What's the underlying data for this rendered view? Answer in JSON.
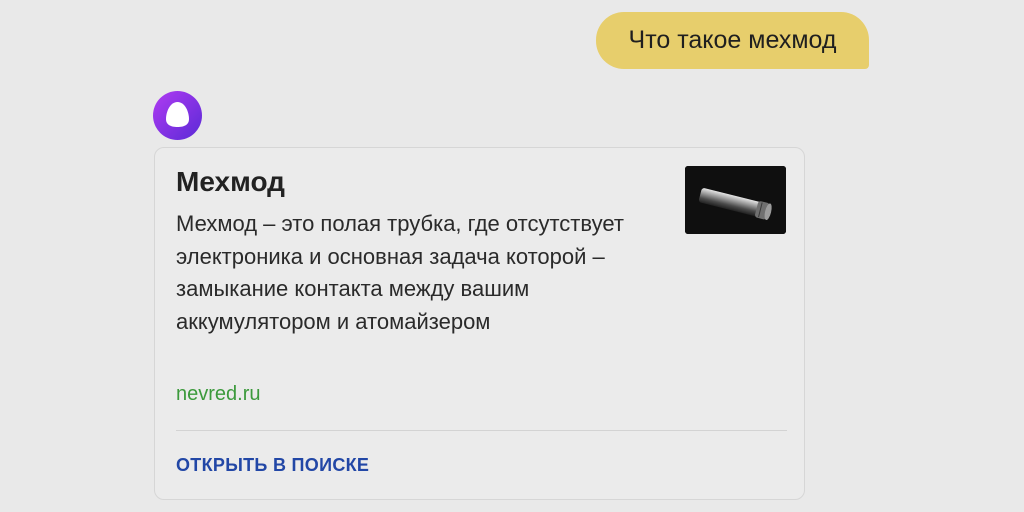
{
  "chat": {
    "user_message": "Что такое мехмод",
    "assistant_icon": "alice-assistant-icon"
  },
  "card": {
    "title": "Мехмод",
    "text": "Мехмод – это полая трубка, где отсутствует электроника и основная задача которой – замыкание контакта между вашим аккумулятором и атомайзером",
    "source": "nevred.ru",
    "action_label": "ОТКРЫТЬ В ПОИСКЕ",
    "image_icon": "mechmod-thumbnail"
  },
  "colors": {
    "background": "#e9e9e9",
    "user_bubble": "#e7ce6c",
    "assistant_accent": "#7a2fe0",
    "source_link": "#3c9a3c",
    "action_link": "#2247a6"
  }
}
